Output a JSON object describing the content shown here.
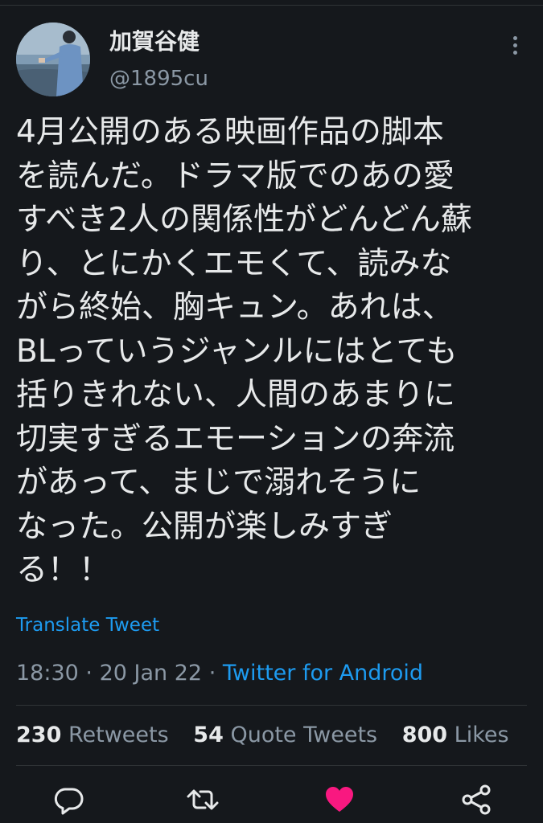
{
  "user": {
    "display_name": "加賀谷健",
    "handle": "@1895cu",
    "avatar_icon": "avatar-photo"
  },
  "tweet": {
    "lines": [
      "4月公開のある映画作品の脚本",
      "を読んだ。ドラマ版でのあの愛",
      "すべき2人の関係性がどんどん蘇",
      "り、とにかくエモくて、読みな",
      "がら終始、胸キュン。あれは、",
      "BLっていうジャンルにはとても",
      "括りきれない、人間のあまりに",
      "切実すぎるエモーションの奔流",
      "があって、まじで溺れそうに",
      "なった。公開が楽しみすぎ",
      "る！！"
    ],
    "translate_label": "Translate Tweet",
    "time": "18:30",
    "sep": "·",
    "date": "20 Jan 22",
    "source": "Twitter for Android"
  },
  "stats": {
    "retweets_count": "230",
    "retweets_label": "Retweets",
    "quotes_count": "54",
    "quotes_label": "Quote Tweets",
    "likes_count": "800",
    "likes_label": "Likes"
  },
  "actions": {
    "reply_icon": "reply-icon",
    "retweet_icon": "retweet-icon",
    "like_icon": "heart-icon",
    "share_icon": "share-icon",
    "like_color": "#f91880",
    "icon_color": "#e7e9ea"
  },
  "colors": {
    "background": "#15181c",
    "link": "#1d9bf0",
    "secondary_text": "#8b98a5",
    "divider": "#2f3336"
  }
}
